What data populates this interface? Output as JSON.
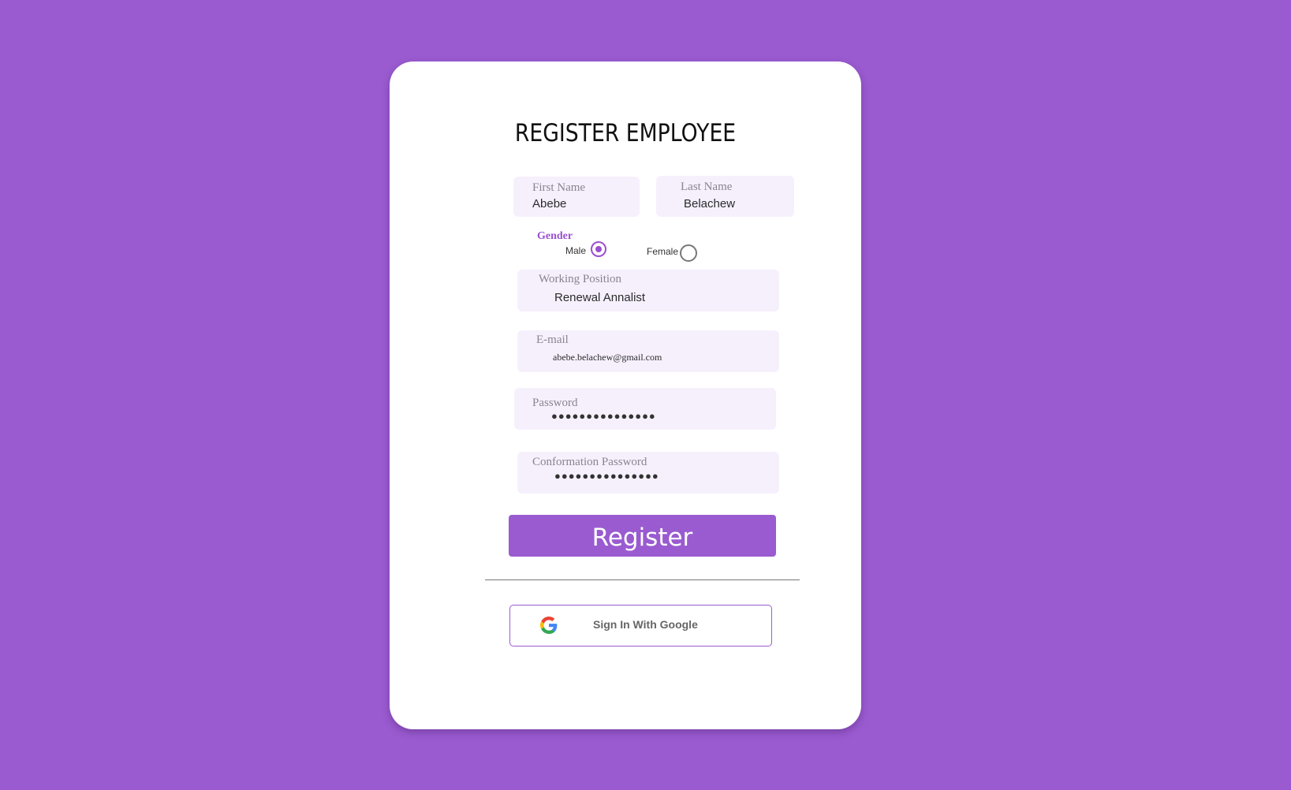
{
  "form": {
    "title": "REGISTER EMPLOYEE",
    "first_name": {
      "label": "First Name",
      "value": "Abebe"
    },
    "last_name": {
      "label": "Last Name",
      "value": "Belachew"
    },
    "gender": {
      "label": "Gender",
      "options": [
        {
          "label": "Male",
          "selected": true
        },
        {
          "label": "Female",
          "selected": false
        }
      ]
    },
    "working_position": {
      "label": "Working Position",
      "value": "Renewal Annalist"
    },
    "email": {
      "label": "E-mail",
      "value": "abebe.belachew@gmail.com"
    },
    "password": {
      "label": "Password",
      "value": "●●●●●●●●●●●●●●●"
    },
    "confirmation_password": {
      "label": "Conformation Password",
      "value": "●●●●●●●●●●●●●●●"
    },
    "register_label": "Register",
    "google_label": "Sign In With Google"
  },
  "colors": {
    "background": "#9a5bd0",
    "accent": "#9a4fd0",
    "field_background": "#f6f0fd",
    "card": "#ffffff"
  },
  "icons": {
    "google": "google-g-icon",
    "radio_checked": "radio-checked-icon",
    "radio_unchecked": "radio-unchecked-icon"
  }
}
